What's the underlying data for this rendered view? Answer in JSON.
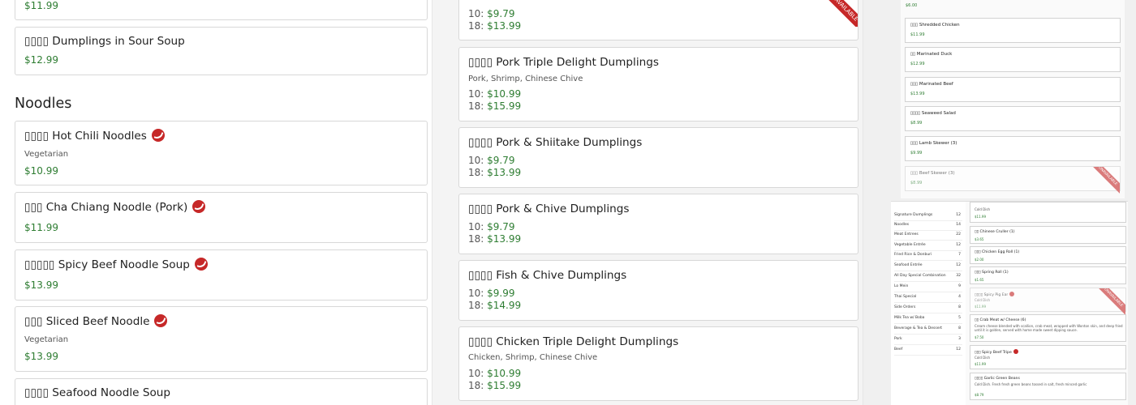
{
  "left": {
    "top_card_price": "$11.99",
    "sour_soup": {
      "title": "▯▯▯▯ Dumplings in Sour Soup",
      "price": "$12.99"
    },
    "noodles_heading": "Noodles",
    "items": [
      {
        "title": "▯▯▯▯ Hot Chili Noodles",
        "desc": "Vegetarian",
        "price": "$10.99",
        "spicy": true
      },
      {
        "title": "▯▯▯ Cha Chiang Noodle (Pork)",
        "desc": "",
        "price": "$11.99",
        "spicy": true
      },
      {
        "title": "▯▯▯▯▯ Spicy Beef Noodle Soup",
        "desc": "",
        "price": "$13.99",
        "spicy": true
      },
      {
        "title": "▯▯▯ Sliced Beef Noodle",
        "desc": "Vegetarian",
        "price": "$13.99",
        "spicy": true
      },
      {
        "title": "▯▯▯▯ Seafood Noodle Soup",
        "desc": "",
        "price": "",
        "spicy": false
      }
    ]
  },
  "middle": {
    "top_card": {
      "p10": "$9.79",
      "p18": "$13.99",
      "ribbon": "UNAVAILABLE"
    },
    "label_10": "10:",
    "label_18": "18:",
    "items": [
      {
        "title": "▯▯▯▯ Pork Triple Delight Dumplings",
        "desc": "Pork, Shrimp, Chinese Chive",
        "p10": "$10.99",
        "p18": "$15.99"
      },
      {
        "title": "▯▯▯▯ Pork & Shiitake Dumplings",
        "desc": "",
        "p10": "$9.79",
        "p18": "$13.99"
      },
      {
        "title": "▯▯▯▯ Pork & Chive Dumplings",
        "desc": "",
        "p10": "$9.79",
        "p18": "$13.99"
      },
      {
        "title": "▯▯▯▯ Fish & Chive Dumplings",
        "desc": "",
        "p10": "$9.99",
        "p18": "$14.99"
      },
      {
        "title": "▯▯▯▯ Chicken Triple Delight Dumplings",
        "desc": "Chicken, Shrimp, Chinese Chive",
        "p10": "$10.99",
        "p18": "$15.99"
      }
    ]
  },
  "right": {
    "thumb1": {
      "top_price": "$6.00",
      "items": [
        {
          "name": "▯▯▯ Shredded Chicken",
          "price": "$11.99"
        },
        {
          "name": "▯▯ Marinated Duck",
          "price": "$12.99"
        },
        {
          "name": "▯▯▯ Marinated Beef",
          "price": "$13.99"
        },
        {
          "name": "▯▯▯▯ Seaweed Salad",
          "price": "$8.99"
        },
        {
          "name": "▯▯▯ Lamb Skewer (3)",
          "price": "$9.99"
        },
        {
          "name": "▯▯▯ Beef Skewer (3)",
          "price": "$8.99"
        }
      ],
      "ribbon": "UNAVAILABLE"
    },
    "thumb2": {
      "categories": [
        {
          "label": "Signature Dumplings",
          "count": "12"
        },
        {
          "label": "Noodles",
          "count": "14"
        },
        {
          "label": "Meat Entrees",
          "count": "22"
        },
        {
          "label": "Vegetable Entrée",
          "count": "12"
        },
        {
          "label": "Fried Rice & Donburi",
          "count": "7"
        },
        {
          "label": "Seafood Entrée",
          "count": "12"
        },
        {
          "label": "All Day Special Combination",
          "count": "32"
        },
        {
          "label": "Lo Mein",
          "count": "9"
        },
        {
          "label": "Thai Special",
          "count": "4"
        },
        {
          "label": "Side Orders",
          "count": "8"
        },
        {
          "label": "Milk Tea w/ Boba",
          "count": "5"
        },
        {
          "label": "Beverage & Tea & Dessert",
          "count": "8"
        },
        {
          "label": "Pork",
          "count": "3"
        },
        {
          "label": "Beef",
          "count": "12"
        }
      ],
      "cards": [
        {
          "name": "Cold Dish",
          "sub": "",
          "price": "$11.99",
          "spicy": false
        },
        {
          "name": "▯▯ Chinese Cruller (1)",
          "sub": "",
          "price": "$3.65",
          "spicy": false
        },
        {
          "name": "▯▯▯ Chicken Egg Roll (1)",
          "sub": "",
          "price": "$2.00",
          "spicy": false
        },
        {
          "name": "▯▯▯ Spring Roll (1)",
          "sub": "",
          "price": "$1.65",
          "spicy": false
        },
        {
          "name": "▯▯▯▯ Spicy Pig Ear",
          "sub": "Cold Dish",
          "price": "$11.99",
          "spicy": true
        },
        {
          "name": "▯▯ Crab Meat w/ Cheese (6)",
          "sub": "Cream cheese blended with scallion, crab meat, wrapped with Wonton skin, and deep fried until it is golden, served with home made sweet dipping sauce.",
          "price": "$7.50",
          "spicy": false
        },
        {
          "name": "▯▯▯ Spicy Beef Tripe",
          "sub": "Cold Dish",
          "price": "$11.99",
          "spicy": true
        },
        {
          "name": "▯▯▯▯ Garlic Green Beans",
          "sub": "Cold Dish. Fresh fresh green beans tossed in salt, fresh minced garlic",
          "price": "$8.79",
          "spicy": false
        }
      ],
      "ribbon": "UNAVAILABLE"
    }
  },
  "colors": {
    "price": "#2e7d32",
    "spicy": "#c62828",
    "ribbon": "#c62828"
  }
}
